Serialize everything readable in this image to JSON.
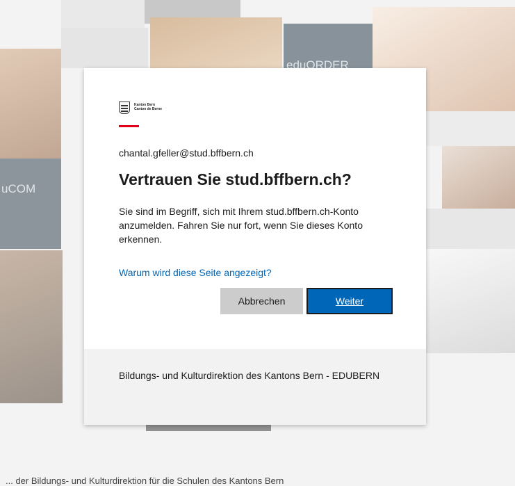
{
  "background": {
    "tile_label_left": "uCOM",
    "tile_label_top": "eduORDER",
    "footer_text": "... der Bildungs- und Kulturdirektion für die Schulen des Kantons Bern"
  },
  "dialog": {
    "logo": {
      "line1": "Kanton Bern",
      "line2": "Canton de Berne",
      "icon": "bern-crest-icon",
      "accent_color": "#e2001a"
    },
    "email": "chantal.gfeller@stud.bffbern.ch",
    "title": "Vertrauen Sie stud.bffbern.ch?",
    "body": "Sie sind im Begriff, sich mit Ihrem stud.bffbern.ch-Konto anzumelden. Fahren Sie nur fort, wenn Sie dieses Konto erkennen.",
    "help_link": "Warum wird diese Seite angezeigt?",
    "buttons": {
      "cancel": "Abbrechen",
      "next": "Weiter"
    },
    "footer": "Bildungs- und Kulturdirektion des Kantons Bern - EDUBERN",
    "colors": {
      "primary": "#0067b8",
      "text": "#1b1b1b",
      "footer_bg": "#f2f2f2"
    }
  }
}
